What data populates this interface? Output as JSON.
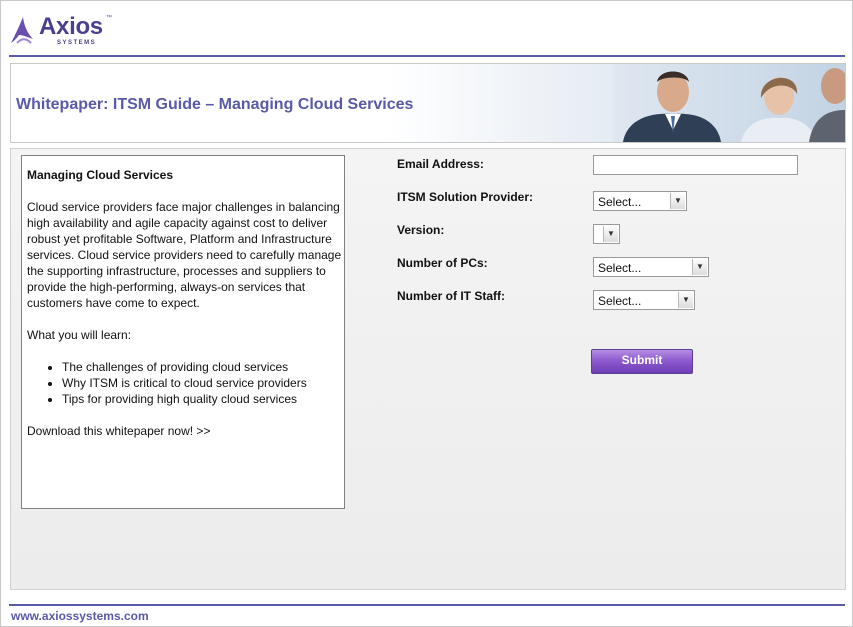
{
  "brand": {
    "name": "Axios",
    "tm": "™",
    "sub": "SYSTEMS",
    "accent": "#5a5aa8",
    "logo_color": "#4b3f8f"
  },
  "banner": {
    "title": "Whitepaper: ITSM Guide – Managing Cloud Services"
  },
  "info": {
    "title": "Managing Cloud Services",
    "paragraph": "Cloud service providers face major challenges in balancing high availability and agile capacity against cost to deliver robust yet profitable Software, Platform and Infrastructure services. Cloud service providers need to carefully manage the supporting infrastructure, processes and suppliers to provide the high-performing, always-on services that customers have come to expect.",
    "learn_heading": "What you will learn:",
    "bullets": [
      "The challenges of providing cloud services",
      "Why ITSM is critical to cloud service providers",
      "Tips for providing high quality cloud services"
    ],
    "cta": "Download this whitepaper now! >>"
  },
  "form": {
    "email_label": "Email Address:",
    "email_value": "",
    "provider_label": "ITSM Solution Provider:",
    "provider_value": "Select...",
    "version_label": "Version:",
    "version_value": "",
    "pcs_label": "Number of PCs:",
    "pcs_value": "Select...",
    "staff_label": "Number of IT Staff:",
    "staff_value": "Select...",
    "submit_label": "Submit",
    "submit_color": "#8a57cc"
  },
  "footer": {
    "url": "www.axiossystems.com"
  }
}
